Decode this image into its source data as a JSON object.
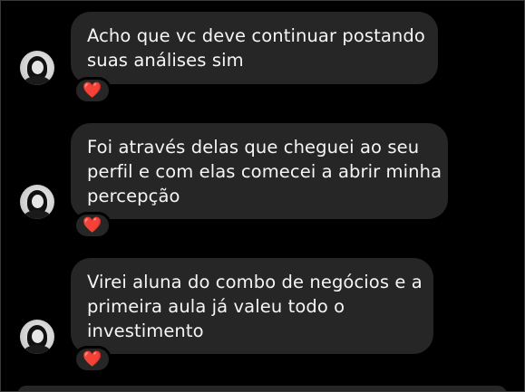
{
  "messages": [
    {
      "lines": [
        "Acho que vc deve continuar postando",
        "suas análises sim"
      ],
      "reaction": "❤️",
      "reaction_icon": "heart-icon"
    },
    {
      "lines": [
        "Foi através delas que cheguei ao seu",
        "perfil e com elas comecei a abrir minha",
        "percepção"
      ],
      "reaction": "❤️",
      "reaction_icon": "heart-icon"
    },
    {
      "lines": [
        "Virei aluna do combo de negócios e a",
        "primeira aula já valeu todo o",
        "investimento"
      ],
      "reaction": "❤️",
      "reaction_icon": "heart-icon"
    }
  ],
  "colors": {
    "background": "#000000",
    "bubble": "#262626",
    "text": "#f5f5f5",
    "heart": "#ff2d3f"
  }
}
